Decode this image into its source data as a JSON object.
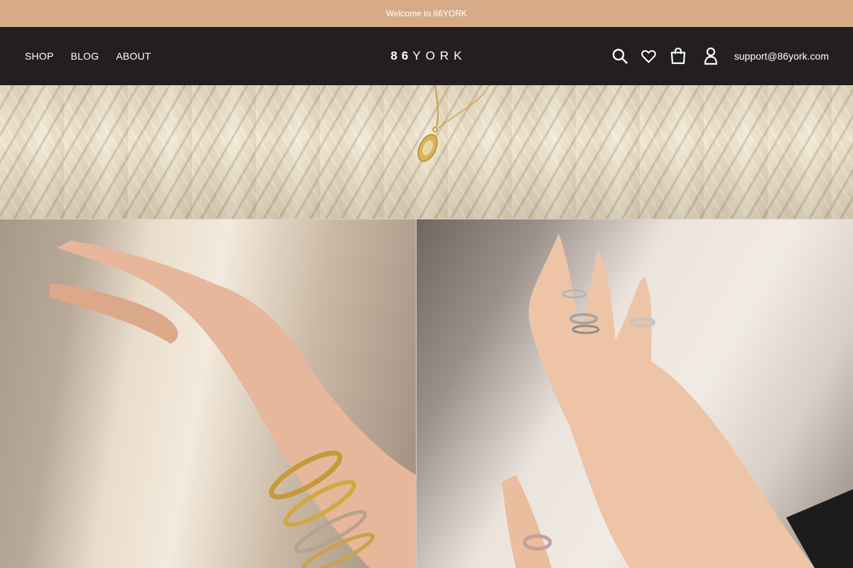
{
  "announcement": {
    "text": "Welcome to 86YORK"
  },
  "header": {
    "nav": [
      {
        "label": "SHOP"
      },
      {
        "label": "BLOG"
      },
      {
        "label": "ABOUT"
      }
    ],
    "logo": {
      "num": "86",
      "word": "YORK"
    },
    "icons": [
      "search-icon",
      "heart-icon",
      "cart-icon",
      "account-icon"
    ],
    "email": "support@86york.com"
  },
  "colors": {
    "announcement_bg": "#d7ab87",
    "header_bg": "#231f20",
    "text": "#ffffff"
  },
  "hero": {
    "top_image": "knit-sweater-pendant-necklace",
    "left_image": "hand-with-gold-bracelets",
    "right_image": "hand-with-silver-rings"
  }
}
